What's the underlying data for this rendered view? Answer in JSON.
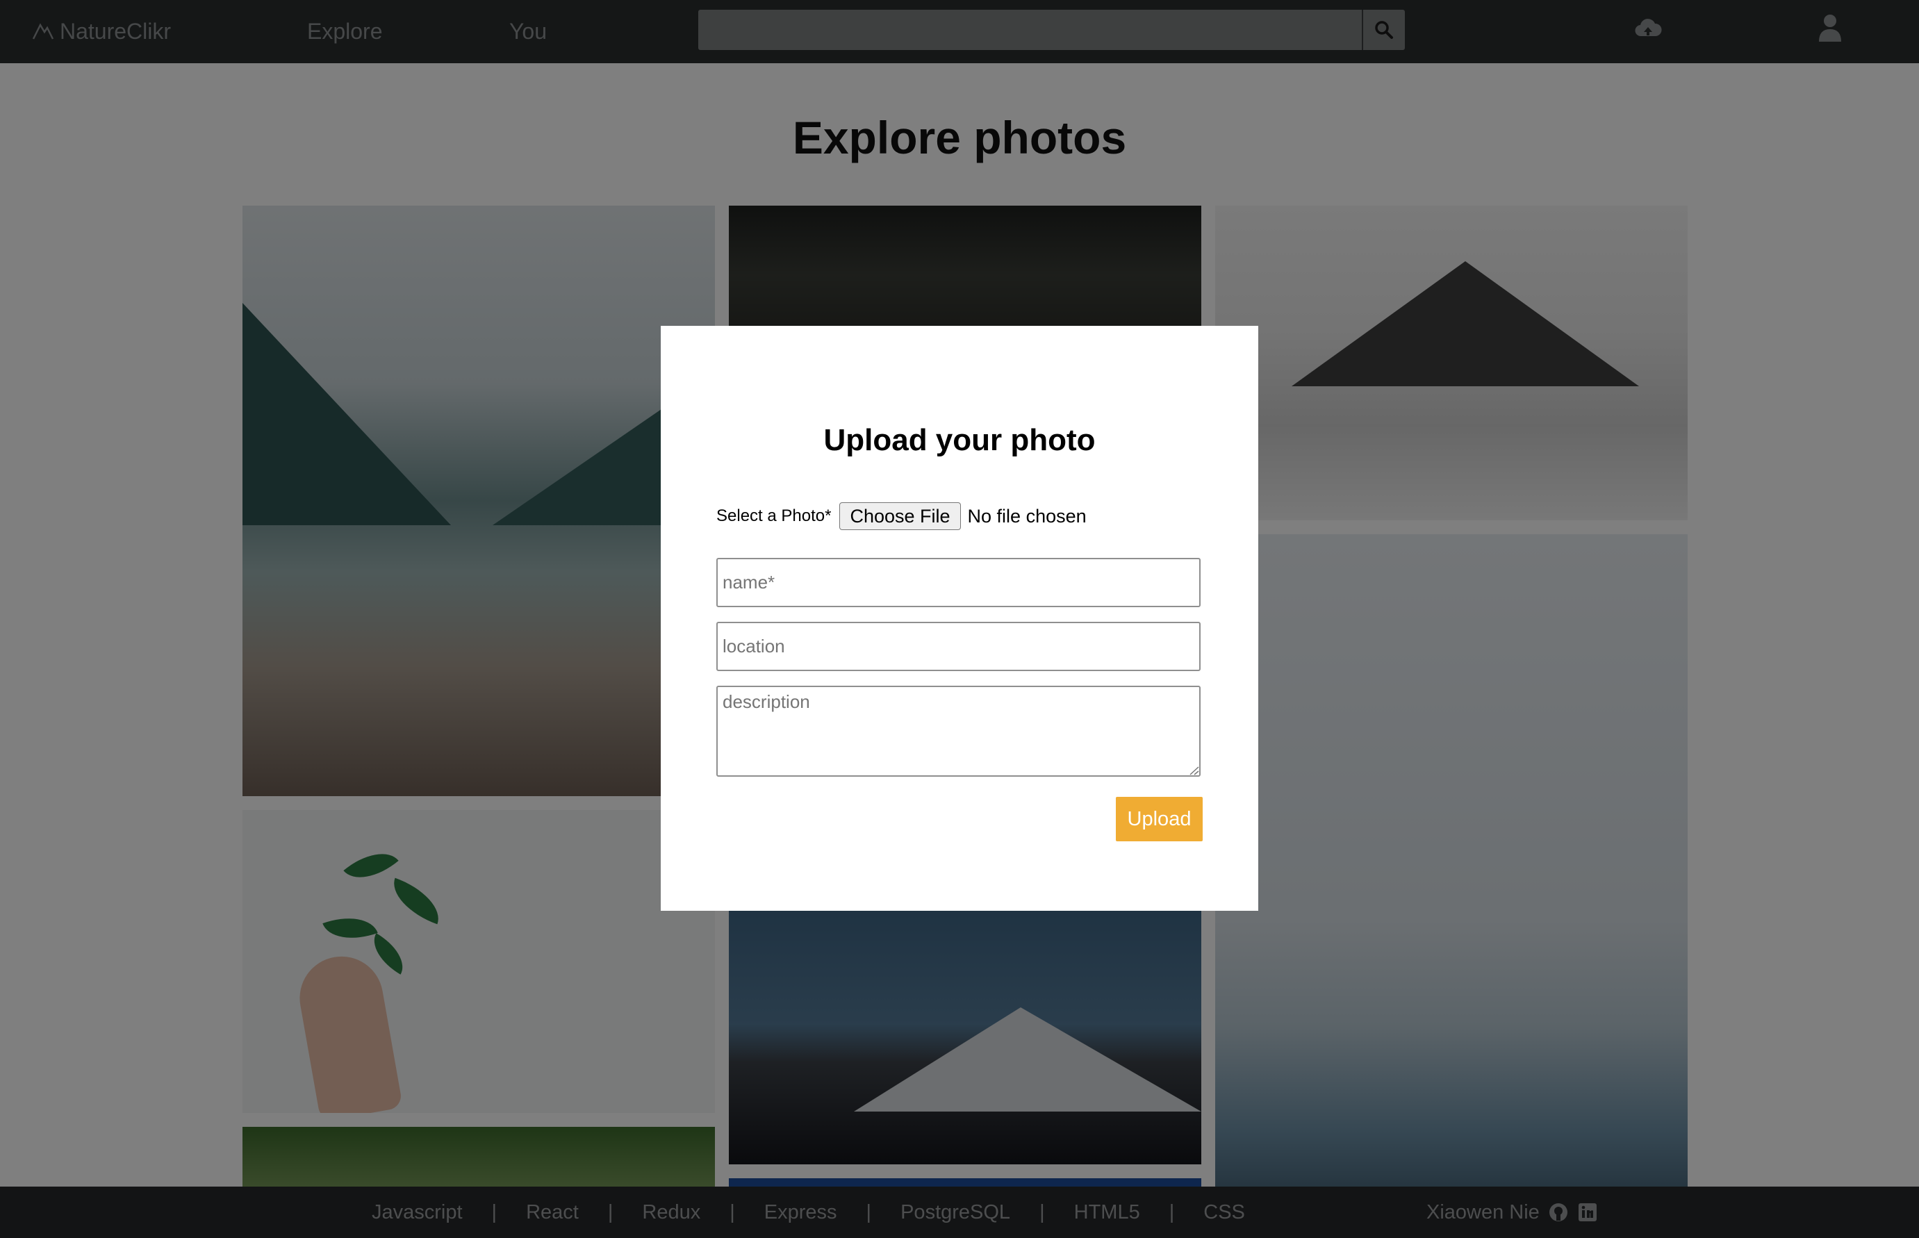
{
  "navbar": {
    "brand": "NatureClikr",
    "links": [
      "Explore",
      "You"
    ],
    "search": {
      "value": "",
      "placeholder": ""
    },
    "icons": {
      "logo": "mountain-icon",
      "search": "search-icon",
      "upload": "cloud-upload-icon",
      "user": "user-icon"
    }
  },
  "page": {
    "title": "Explore photos"
  },
  "modal": {
    "title": "Upload your photo",
    "file_label": "Select a Photo*",
    "choose_file_label": "Choose File",
    "no_file_text": "No file chosen",
    "fields": {
      "name": {
        "value": "",
        "placeholder": "name*"
      },
      "location": {
        "value": "",
        "placeholder": "location"
      },
      "description": {
        "value": "",
        "placeholder": "description"
      }
    },
    "upload_label": "Upload",
    "accent_color": "#f0ac33"
  },
  "footer": {
    "tech": [
      "Javascript",
      "React",
      "Redux",
      "Express",
      "PostgreSQL",
      "HTML5",
      "CSS"
    ],
    "separator": "|",
    "author": "Xiaowen Nie",
    "icons": [
      "github-icon",
      "linkedin-icon"
    ]
  }
}
